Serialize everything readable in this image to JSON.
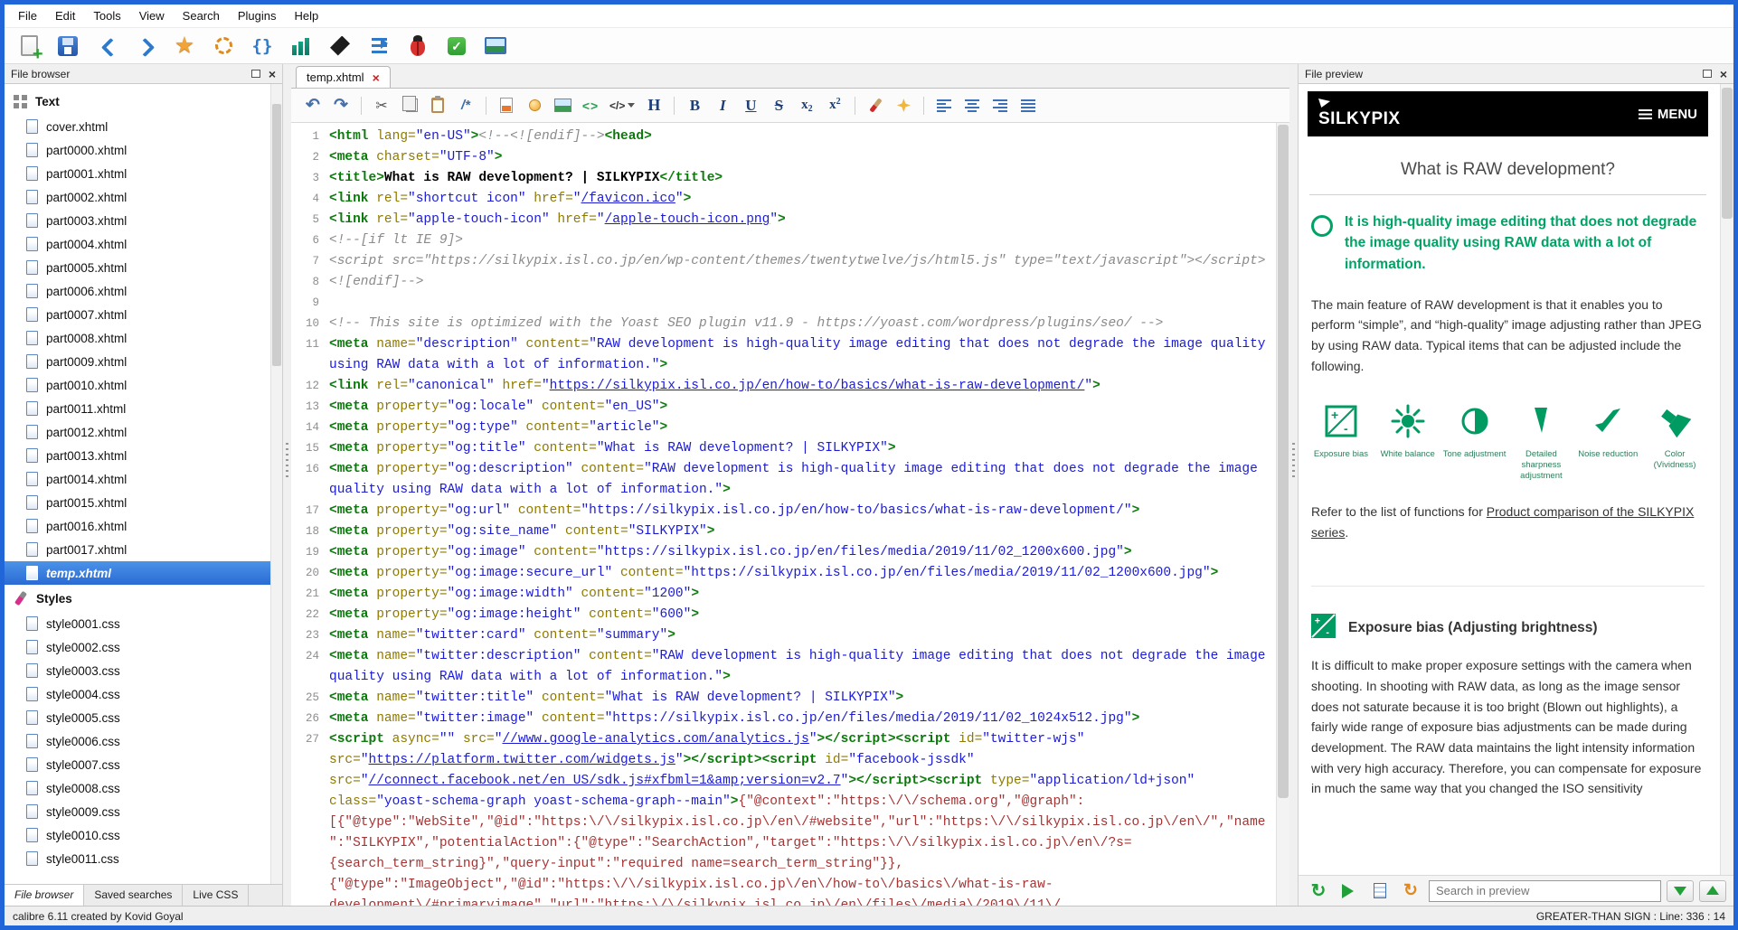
{
  "menubar": [
    "File",
    "Edit",
    "Tools",
    "View",
    "Search",
    "Plugins",
    "Help"
  ],
  "toolbar": [
    "new-file",
    "save",
    "back",
    "forward",
    "bookmark",
    "sync",
    "braces",
    "columns",
    "trowel",
    "arrange",
    "check-book",
    "spell-check",
    "insert-image"
  ],
  "colors": {
    "accent_green": "#009a63",
    "tag_green": "#0a7a0a",
    "attr_olive": "#8f7a00",
    "value_blue": "#1b1bd6",
    "comment_gray": "#8a8a8a",
    "json_red": "#a63333",
    "selection_blue": "#2a6bd4",
    "window_border": "#2066d8"
  },
  "sidebar": {
    "title": "File browser",
    "selected": "temp.xhtml",
    "sections": [
      {
        "label": "Text",
        "icon": "grid-icon",
        "items": [
          "cover.xhtml",
          "part0000.xhtml",
          "part0001.xhtml",
          "part0002.xhtml",
          "part0003.xhtml",
          "part0004.xhtml",
          "part0005.xhtml",
          "part0006.xhtml",
          "part0007.xhtml",
          "part0008.xhtml",
          "part0009.xhtml",
          "part0010.xhtml",
          "part0011.xhtml",
          "part0012.xhtml",
          "part0013.xhtml",
          "part0014.xhtml",
          "part0015.xhtml",
          "part0016.xhtml",
          "part0017.xhtml",
          "temp.xhtml"
        ]
      },
      {
        "label": "Styles",
        "icon": "brush-icon",
        "items": [
          "style0001.css",
          "style0002.css",
          "style0003.css",
          "style0004.css",
          "style0005.css",
          "style0006.css",
          "style0007.css",
          "style0008.css",
          "style0009.css",
          "style0010.css",
          "style0011.css"
        ]
      }
    ],
    "tabs": [
      "File browser",
      "Saved searches",
      "Live CSS"
    ],
    "active_tab": "File browser"
  },
  "editor": {
    "tab_label": "temp.xhtml",
    "toolbar": [
      "undo",
      "redo",
      "sep",
      "cut",
      "copy",
      "paste",
      "comment",
      "sep",
      "htmlfile",
      "bulb",
      "image2",
      "tags",
      "codeblock",
      "heading",
      "sep",
      "bold",
      "italic",
      "underline",
      "strike",
      "sub",
      "sup",
      "sep",
      "fgcolor",
      "bgcolor",
      "sep",
      "align-left",
      "align-center",
      "align-right",
      "align-justify"
    ],
    "lines": [
      {
        "n": 1,
        "tk": [
          [
            "t",
            "<html"
          ],
          [
            "a",
            " lang="
          ],
          [
            "v",
            "\"en-US\""
          ],
          [
            "t",
            ">"
          ],
          [
            "c",
            "<!--<![endif]-->"
          ],
          [
            "t",
            "<head>"
          ]
        ]
      },
      {
        "n": 2,
        "tk": [
          [
            "t",
            "<meta"
          ],
          [
            "a",
            " charset="
          ],
          [
            "v",
            "\"UTF-8\""
          ],
          [
            "t",
            ">"
          ]
        ]
      },
      {
        "n": 3,
        "tk": [
          [
            "t",
            "<title>"
          ],
          [
            "x",
            "What is RAW development? | SILKYPIX"
          ],
          [
            "t",
            "</title>"
          ]
        ]
      },
      {
        "n": 4,
        "tk": [
          [
            "t",
            "<link"
          ],
          [
            "a",
            " rel="
          ],
          [
            "v",
            "\"shortcut icon\""
          ],
          [
            "a",
            " href="
          ],
          [
            "v",
            "\""
          ],
          [
            "l",
            "/favicon.ico"
          ],
          [
            "v",
            "\""
          ],
          [
            "t",
            ">"
          ]
        ]
      },
      {
        "n": 5,
        "tk": [
          [
            "t",
            "<link"
          ],
          [
            "a",
            " rel="
          ],
          [
            "v",
            "\"apple-touch-icon\""
          ],
          [
            "a",
            " href="
          ],
          [
            "v",
            "\""
          ],
          [
            "l",
            "/apple-touch-icon.png"
          ],
          [
            "v",
            "\""
          ],
          [
            "t",
            ">"
          ]
        ]
      },
      {
        "n": 6,
        "tk": [
          [
            "c",
            "<!--[if lt IE 9]>"
          ]
        ]
      },
      {
        "n": 7,
        "tk": [
          [
            "c",
            "<script src=\"https://silkypix.isl.co.jp/en/wp-content/themes/twentytwelve/js/html5.js\" type=\"text/javascript\"></script>"
          ]
        ]
      },
      {
        "n": 8,
        "tk": [
          [
            "c",
            "<![endif]-->"
          ]
        ]
      },
      {
        "n": 9,
        "tk": []
      },
      {
        "n": 10,
        "tk": [
          [
            "c",
            "<!-- This site is optimized with the Yoast SEO plugin v11.9 - https://yoast.com/wordpress/plugins/seo/ -->"
          ]
        ]
      },
      {
        "n": 11,
        "tk": [
          [
            "t",
            "<meta"
          ],
          [
            "a",
            " name="
          ],
          [
            "v",
            "\"description\""
          ],
          [
            "a",
            " content="
          ],
          [
            "v",
            "\"RAW development is high-quality image editing that does not degrade the image quality using RAW data with a lot of information.\""
          ],
          [
            "t",
            ">"
          ]
        ]
      },
      {
        "n": 12,
        "tk": [
          [
            "t",
            "<link"
          ],
          [
            "a",
            " rel="
          ],
          [
            "v",
            "\"canonical\""
          ],
          [
            "a",
            " href="
          ],
          [
            "v",
            "\""
          ],
          [
            "l",
            "https://silkypix.isl.co.jp/en/how-to/basics/what-is-raw-development/"
          ],
          [
            "v",
            "\""
          ],
          [
            "t",
            ">"
          ]
        ]
      },
      {
        "n": 13,
        "tk": [
          [
            "t",
            "<meta"
          ],
          [
            "a",
            " property="
          ],
          [
            "v",
            "\"og:locale\""
          ],
          [
            "a",
            " content="
          ],
          [
            "v",
            "\"en_US\""
          ],
          [
            "t",
            ">"
          ]
        ]
      },
      {
        "n": 14,
        "tk": [
          [
            "t",
            "<meta"
          ],
          [
            "a",
            " property="
          ],
          [
            "v",
            "\"og:type\""
          ],
          [
            "a",
            " content="
          ],
          [
            "v",
            "\"article\""
          ],
          [
            "t",
            ">"
          ]
        ]
      },
      {
        "n": 15,
        "tk": [
          [
            "t",
            "<meta"
          ],
          [
            "a",
            " property="
          ],
          [
            "v",
            "\"og:title\""
          ],
          [
            "a",
            " content="
          ],
          [
            "v",
            "\"What is RAW development? | SILKYPIX\""
          ],
          [
            "t",
            ">"
          ]
        ]
      },
      {
        "n": 16,
        "tk": [
          [
            "t",
            "<meta"
          ],
          [
            "a",
            " property="
          ],
          [
            "v",
            "\"og:description\""
          ],
          [
            "a",
            " content="
          ],
          [
            "v",
            "\"RAW development is high-quality image editing that does not degrade the image quality using RAW data with a lot of information.\""
          ],
          [
            "t",
            ">"
          ]
        ]
      },
      {
        "n": 17,
        "tk": [
          [
            "t",
            "<meta"
          ],
          [
            "a",
            " property="
          ],
          [
            "v",
            "\"og:url\""
          ],
          [
            "a",
            " content="
          ],
          [
            "v",
            "\"https://silkypix.isl.co.jp/en/how-to/basics/what-is-raw-development/\""
          ],
          [
            "t",
            ">"
          ]
        ]
      },
      {
        "n": 18,
        "tk": [
          [
            "t",
            "<meta"
          ],
          [
            "a",
            " property="
          ],
          [
            "v",
            "\"og:site_name\""
          ],
          [
            "a",
            " content="
          ],
          [
            "v",
            "\"SILKYPIX\""
          ],
          [
            "t",
            ">"
          ]
        ]
      },
      {
        "n": 19,
        "tk": [
          [
            "t",
            "<meta"
          ],
          [
            "a",
            " property="
          ],
          [
            "v",
            "\"og:image\""
          ],
          [
            "a",
            " content="
          ],
          [
            "v",
            "\"https://silkypix.isl.co.jp/en/files/media/2019/11/02_1200x600.jpg\""
          ],
          [
            "t",
            ">"
          ]
        ]
      },
      {
        "n": 20,
        "tk": [
          [
            "t",
            "<meta"
          ],
          [
            "a",
            " property="
          ],
          [
            "v",
            "\"og:image:secure_url\""
          ],
          [
            "a",
            " content="
          ],
          [
            "v",
            "\"https://silkypix.isl.co.jp/en/files/media/2019/11/02_1200x600.jpg\""
          ],
          [
            "t",
            ">"
          ]
        ]
      },
      {
        "n": 21,
        "tk": [
          [
            "t",
            "<meta"
          ],
          [
            "a",
            " property="
          ],
          [
            "v",
            "\"og:image:width\""
          ],
          [
            "a",
            " content="
          ],
          [
            "v",
            "\"1200\""
          ],
          [
            "t",
            ">"
          ]
        ]
      },
      {
        "n": 22,
        "tk": [
          [
            "t",
            "<meta"
          ],
          [
            "a",
            " property="
          ],
          [
            "v",
            "\"og:image:height\""
          ],
          [
            "a",
            " content="
          ],
          [
            "v",
            "\"600\""
          ],
          [
            "t",
            ">"
          ]
        ]
      },
      {
        "n": 23,
        "tk": [
          [
            "t",
            "<meta"
          ],
          [
            "a",
            " name="
          ],
          [
            "v",
            "\"twitter:card\""
          ],
          [
            "a",
            " content="
          ],
          [
            "v",
            "\"summary\""
          ],
          [
            "t",
            ">"
          ]
        ]
      },
      {
        "n": 24,
        "tk": [
          [
            "t",
            "<meta"
          ],
          [
            "a",
            " name="
          ],
          [
            "v",
            "\"twitter:description\""
          ],
          [
            "a",
            " content="
          ],
          [
            "v",
            "\"RAW development is high-quality image editing that does not degrade the image quality using RAW data with a lot of information.\""
          ],
          [
            "t",
            ">"
          ]
        ]
      },
      {
        "n": 25,
        "tk": [
          [
            "t",
            "<meta"
          ],
          [
            "a",
            " name="
          ],
          [
            "v",
            "\"twitter:title\""
          ],
          [
            "a",
            " content="
          ],
          [
            "v",
            "\"What is RAW development? | SILKYPIX\""
          ],
          [
            "t",
            ">"
          ]
        ]
      },
      {
        "n": 26,
        "tk": [
          [
            "t",
            "<meta"
          ],
          [
            "a",
            " name="
          ],
          [
            "v",
            "\"twitter:image\""
          ],
          [
            "a",
            " content="
          ],
          [
            "v",
            "\"https://silkypix.isl.co.jp/en/files/media/2019/11/02_1024x512.jpg\""
          ],
          [
            "t",
            ">"
          ]
        ]
      },
      {
        "n": 27,
        "tk": [
          [
            "t",
            "<script"
          ],
          [
            "a",
            " async="
          ],
          [
            "v",
            "\"\""
          ],
          [
            "a",
            " src="
          ],
          [
            "v",
            "\""
          ],
          [
            "l",
            "//www.google-analytics.com/analytics.js"
          ],
          [
            "v",
            "\""
          ],
          [
            "t",
            "></script>"
          ],
          [
            "t",
            "<script"
          ],
          [
            "a",
            " id="
          ],
          [
            "v",
            "\"twitter-wjs\""
          ],
          [
            "a",
            " src="
          ],
          [
            "v",
            "\""
          ],
          [
            "l",
            "https://platform.twitter.com/widgets.js"
          ],
          [
            "v",
            "\""
          ],
          [
            "t",
            "></script>"
          ],
          [
            "t",
            "<script"
          ],
          [
            "a",
            " id="
          ],
          [
            "v",
            "\"facebook-jssdk\""
          ],
          [
            "a",
            " src="
          ],
          [
            "v",
            "\""
          ],
          [
            "l",
            "//connect.facebook.net/en_US/sdk.js#xfbml=1&amp;version=v2.7"
          ],
          [
            "v",
            "\""
          ],
          [
            "t",
            "></script>"
          ],
          [
            "t",
            "<script"
          ],
          [
            "a",
            " type="
          ],
          [
            "v",
            "\"application/ld+json\""
          ],
          [
            "a",
            " class="
          ],
          [
            "v",
            "\"yoast-schema-graph yoast-schema-graph--main\""
          ],
          [
            "t",
            ">"
          ],
          [
            "j",
            "{\"@context\":\"https:\\/\\/schema.org\",\"@graph\":[{\"@type\":\"WebSite\",\"@id\":\"https:\\/\\/silkypix.isl.co.jp\\/en\\/#website\",\"url\":\"https:\\/\\/silkypix.isl.co.jp\\/en\\/\",\"name\":\"SILKYPIX\",\"potentialAction\":{\"@type\":\"SearchAction\",\"target\":\"https:\\/\\/silkypix.isl.co.jp\\/en\\/?s={search_term_string}\",\"query-input\":\"required name=search_term_string\"}},{\"@type\":\"ImageObject\",\"@id\":\"https:\\/\\/silkypix.isl.co.jp\\/en\\/how-to\\/basics\\/what-is-raw-development\\/#primaryimage\",\"url\":\"https:\\/\\/silkypix.isl.co.jp\\/en\\/files\\/media\\/2019\\/11\\/"
          ]
        ]
      }
    ]
  },
  "preview": {
    "title": "File preview",
    "search_placeholder": "Search in preview",
    "site": {
      "logo": "SILKYPIX",
      "menu": "MENU",
      "heading": "What is RAW development?",
      "lead": "It is high-quality image editing that does not degrade the image quality using RAW data with a lot of information.",
      "para1": "The main feature of RAW development is that it enables you to perform “simple”, and “high-quality” image adjusting rather than JPEG by using RAW data. Typical items that can be adjusted include the following.",
      "functions": [
        {
          "icon": "exposure",
          "label": "Exposure bias"
        },
        {
          "icon": "white-balance",
          "label": "White balance"
        },
        {
          "icon": "tone",
          "label": "Tone adjustment"
        },
        {
          "icon": "sharpness",
          "label": "Detailed sharpness adjustment"
        },
        {
          "icon": "noise",
          "label": "Noise reduction"
        },
        {
          "icon": "color",
          "label": "Color (Vividness)"
        }
      ],
      "refer_prefix": "Refer to the list of functions for ",
      "refer_link": "Product comparison of the SILKYPIX series",
      "refer_suffix": ".",
      "section_title": "Exposure bias (Adjusting brightness)",
      "para2": "It is difficult to make proper exposure settings with the camera when shooting. In shooting with RAW data, as long as the image sensor does not saturate because it is too bright (Blown out highlights), a fairly wide range of exposure bias adjustments can be made during development. The RAW data maintains the light intensity information with very high accuracy. Therefore, you can compensate for exposure in much the same way that you changed the ISO sensitivity"
    }
  },
  "statusbar": {
    "left": "calibre 6.11 created by Kovid Goyal",
    "right": "GREATER-THAN SIGN : Line: 336 : 14"
  }
}
